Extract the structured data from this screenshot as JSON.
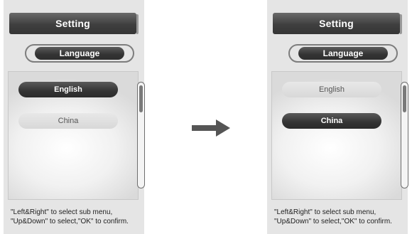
{
  "panels": [
    {
      "title": "Setting",
      "tab_label": "Language",
      "options": [
        {
          "label": "English",
          "selected": true
        },
        {
          "label": "China",
          "selected": false
        }
      ],
      "help": {
        "line1": "\"Left&Right\" to select sub menu,",
        "line2": "\"Up&Down\" to select,\"OK\" to confirm."
      }
    },
    {
      "title": "Setting",
      "tab_label": "Language",
      "options": [
        {
          "label": "English",
          "selected": false
        },
        {
          "label": "China",
          "selected": true
        }
      ],
      "help": {
        "line1": "\"Left&Right\" to select sub menu,",
        "line2": "\"Up&Down\" to select,\"OK\" to confirm."
      }
    }
  ],
  "arrow_icon": "right-arrow-icon",
  "colors": {
    "selected_fill": "#333333",
    "unselected_fill": "#dcdcdc",
    "panel_bg": "#e5e5e5"
  }
}
